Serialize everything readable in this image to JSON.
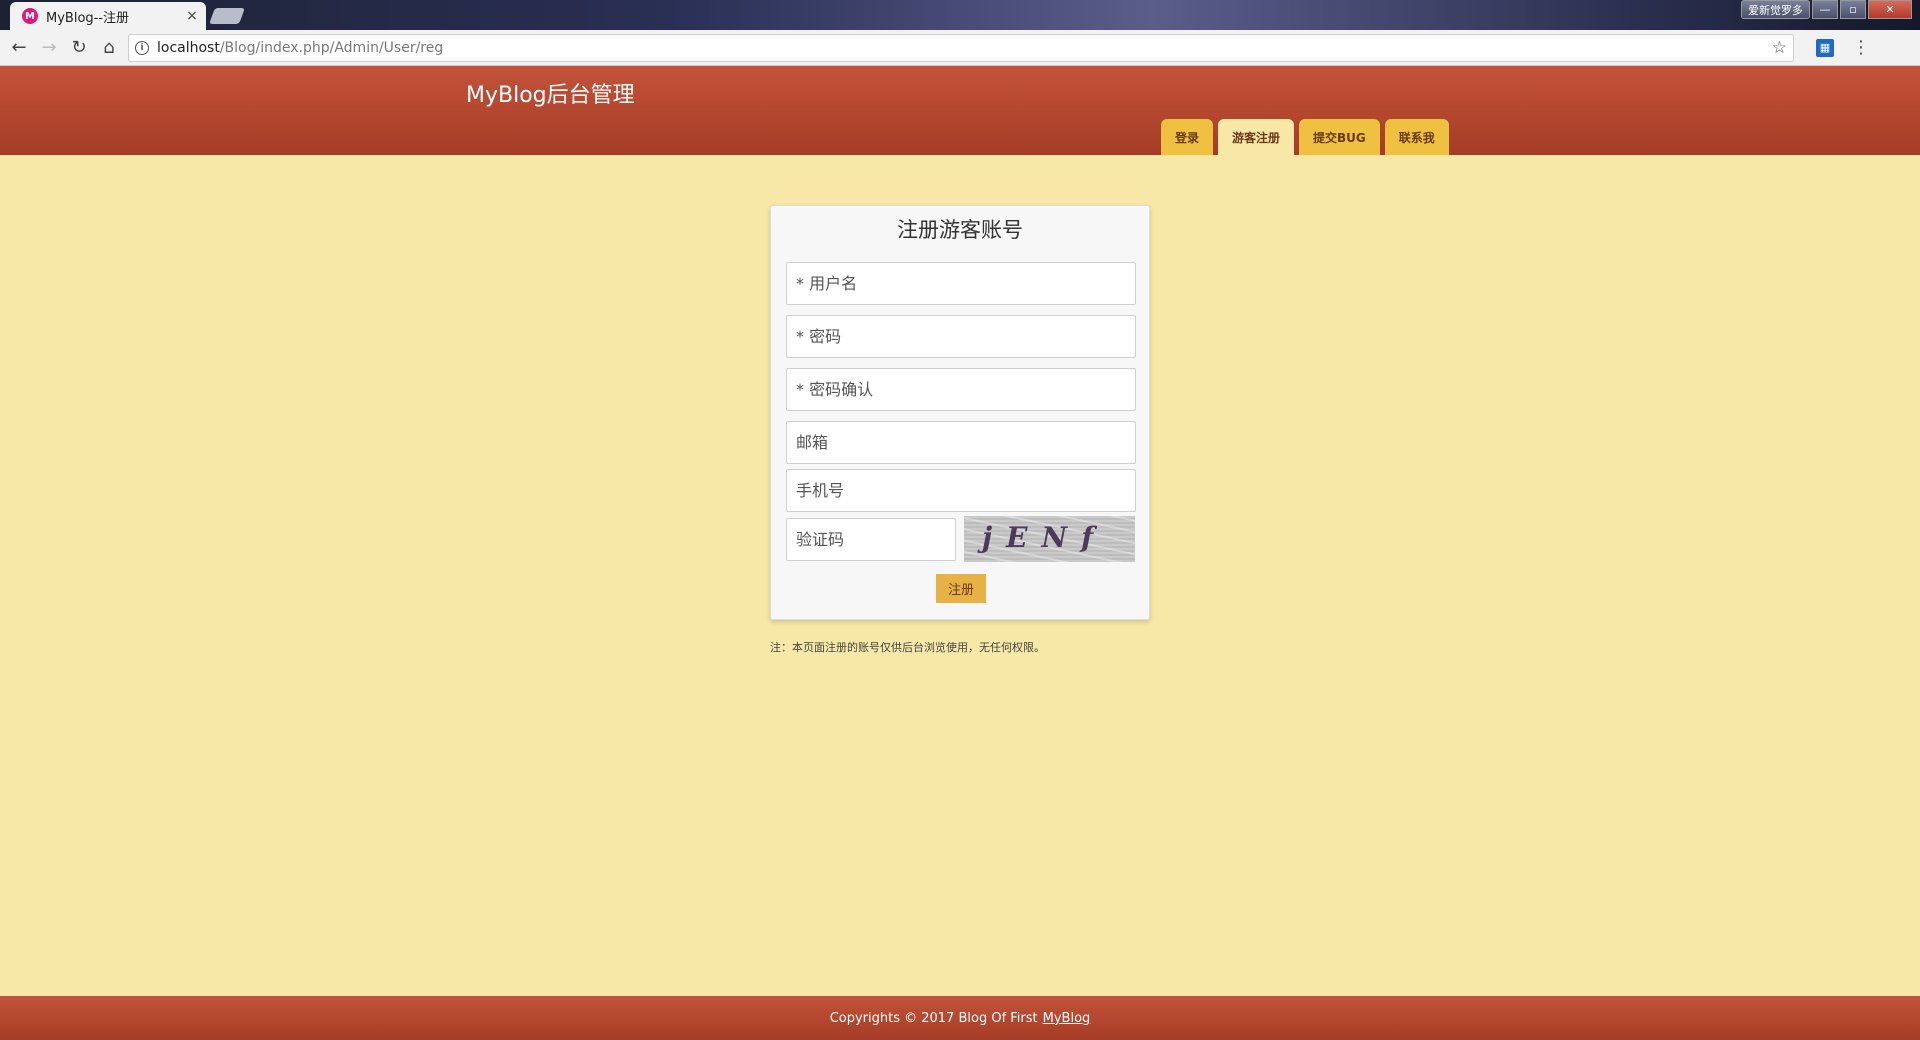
{
  "browser": {
    "tab_title": "MyBlog--注册",
    "tab_favicon_glyph": "M",
    "tab_close": "×",
    "url_host": "localhost",
    "url_path": "/Blog/index.php/Admin/User/reg",
    "user_badge": "爱新觉罗多",
    "win_minimize": "—",
    "win_maximize": "▫",
    "win_close": "✕",
    "icons": [
      "back-arrow-icon",
      "forward-arrow-icon",
      "reload-icon",
      "home-icon",
      "info-icon",
      "star-icon",
      "extension-icon",
      "menu-icon"
    ]
  },
  "header": {
    "title": "MyBlog后台管理",
    "nav": [
      {
        "label": "登录",
        "active": false
      },
      {
        "label": "游客注册",
        "active": true
      },
      {
        "label": "提交BUG",
        "active": false
      },
      {
        "label": "联系我",
        "active": false
      }
    ]
  },
  "form": {
    "title": "注册游客账号",
    "username_placeholder": "* 用户名",
    "password_placeholder": "* 密码",
    "password_confirm_placeholder": "* 密码确认",
    "email_placeholder": "邮箱",
    "phone_placeholder": "手机号",
    "captcha_placeholder": "验证码",
    "captcha_text": "jENf",
    "submit_label": "注册"
  },
  "note": "注：本页面注册的账号仅供后台浏览使用，无任何权限。",
  "footer": {
    "text": "Copyrights © 2017 Blog Of First",
    "link": "MyBlog"
  },
  "colors": {
    "header_bg": "#b84a30",
    "page_bg": "#f8e8a8",
    "tab_bg": "#f0c040",
    "button_bg": "#e7b243"
  }
}
